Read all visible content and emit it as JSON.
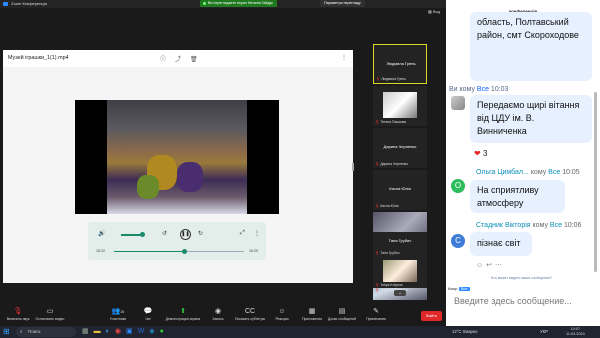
{
  "window": {
    "title": "Zoom Конференція"
  },
  "share_bar": {
    "text": "Ви переглядаєте екран Наталія Гайдук"
  },
  "view_button": "Параметри перегляду",
  "grid_button": "Вид",
  "shared": {
    "file_name": "Музей іграшки_1(1).mp4",
    "time_current": "15:22",
    "time_total": "16:29",
    "seek_fraction": 0.54
  },
  "participants": [
    {
      "name": "Людмила Грень",
      "label": "Людмила Грень",
      "highlighted": true
    },
    {
      "name": "",
      "label": "Тетяна Пашкова"
    },
    {
      "name": "Дарина Черненко",
      "label": "Дарина Черненко"
    },
    {
      "name": "Кисла Юлія",
      "label": "Кисла Юлія"
    },
    {
      "name": "",
      "label": "Наталія Гайдук"
    },
    {
      "name": "",
      "label": "Дарина Черненко"
    },
    {
      "name": "Таня Грубич",
      "label": "Таня Грубич"
    },
    {
      "name": "",
      "label": "Yuliya.Kotyeva"
    }
  ],
  "toolbar": [
    {
      "icon": "mic-muted-icon",
      "label": "Включить звук"
    },
    {
      "icon": "video-icon",
      "label": "Остановить видео"
    },
    {
      "icon": "participants-icon",
      "label": "Участники",
      "count": "26"
    },
    {
      "icon": "chat-icon",
      "label": "Чат"
    },
    {
      "icon": "share-icon",
      "label": "Демонстрация экрана"
    },
    {
      "icon": "record-icon",
      "label": "Запись"
    },
    {
      "icon": "captions-icon",
      "label": "Показать субтитры"
    },
    {
      "icon": "reactions-icon",
      "label": "Реакции"
    },
    {
      "icon": "apps-icon",
      "label": "Приложения"
    },
    {
      "icon": "whiteboard-icon",
      "label": "Доски сообщений"
    },
    {
      "icon": "notes-icon",
      "label": "Примечания"
    }
  ],
  "leave_label": "Выйти",
  "chat": {
    "header": "конференція",
    "messages": [
      {
        "text": "область, Полтавський район, смт Скороходове"
      },
      {
        "meta_prefix": "Ви кому",
        "meta_to": "Все",
        "time": "10:03",
        "text": "Передаємо щирі вітання від ЦДУ ім. В. Винниченка",
        "reaction": "3"
      },
      {
        "sender": "Ольга Цимбал...",
        "to_prefix": "кому",
        "to": "Все",
        "time": "10:05",
        "avatar": "О",
        "text": "На сприятливу атмосферу"
      },
      {
        "sender": "Стадник Вікторія",
        "to_prefix": "кому",
        "to": "Все",
        "time": "10:06",
        "avatar": "С",
        "text": "пізнає світ"
      }
    ],
    "who_hint": "Кто может видеть ваши сообщения?",
    "to_label": "Кому:",
    "to_value": "Все",
    "input_placeholder": "Введите здесь сообщение..."
  },
  "taskbar": {
    "search": "Поиск",
    "weather": "12°C Хмарно",
    "language": "УКР",
    "time": "10:07",
    "date": "11.04.2024"
  }
}
